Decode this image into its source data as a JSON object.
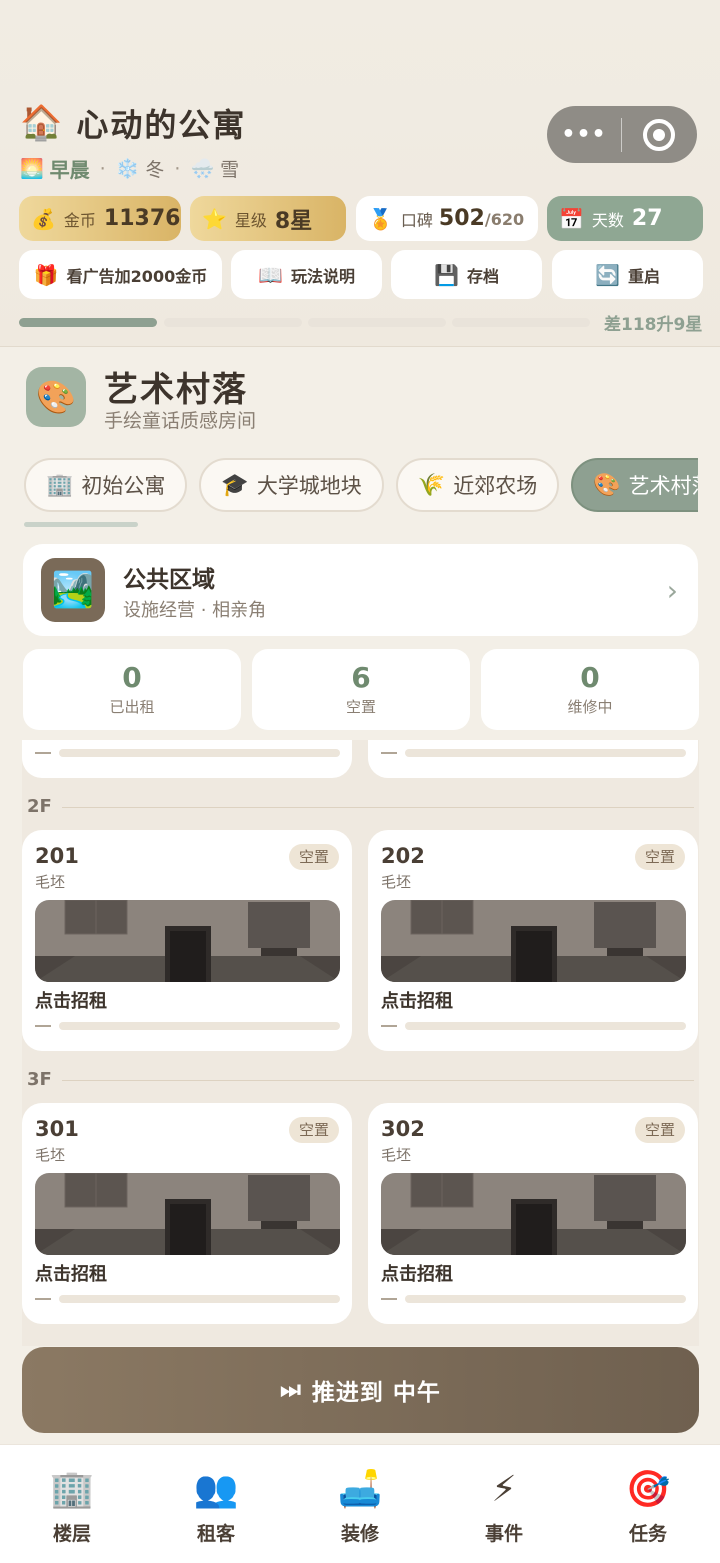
{
  "header": {
    "title": "心动的公寓",
    "title_icon": "🏠",
    "time_icon": "🌅",
    "time_of_day": "早晨",
    "season_icon": "❄️",
    "season": "冬",
    "weather_icon": "🌨️",
    "weather": "雪",
    "separator": "·"
  },
  "capsule": {
    "more": "•••"
  },
  "stats": {
    "coins_label": "金币",
    "coins_value": "11376",
    "coins_icon": "💰",
    "stars_label": "星级",
    "stars_value": "8星",
    "stars_icon": "⭐",
    "rep_label": "口碑",
    "rep_value": "502",
    "rep_max": "/620",
    "rep_icon": "🏅",
    "days_label": "天数",
    "days_value": "27",
    "days_icon": "📅"
  },
  "actions": {
    "ad": "看广告加2000金币",
    "ad_icon": "🎁",
    "guide": "玩法说明",
    "guide_icon": "📖",
    "save": "存档",
    "save_icon": "💾",
    "restart": "重启",
    "restart_icon": "🔄"
  },
  "progress": {
    "text": "差118升9星",
    "filled_segments": 1,
    "total_segments": 4
  },
  "area": {
    "icon": "🎨",
    "name": "艺术村落",
    "subtitle": "手绘童话质感房间"
  },
  "tabs": [
    {
      "icon": "🏢",
      "label": "初始公寓"
    },
    {
      "icon": "🎓",
      "label": "大学城地块"
    },
    {
      "icon": "🌾",
      "label": "近郊农场"
    },
    {
      "icon": "🎨",
      "label": "艺术村落"
    }
  ],
  "public_area": {
    "icon": "🏞️",
    "title": "公共区域",
    "subtitle": "设施经营 · 相亲角",
    "chevron": "›"
  },
  "counts": [
    {
      "value": "0",
      "label": "已出租"
    },
    {
      "value": "6",
      "label": "空置"
    },
    {
      "value": "0",
      "label": "维修中"
    }
  ],
  "floors": [
    {
      "label": "2F",
      "rooms": [
        {
          "number": "201",
          "type": "毛坯",
          "status": "空置",
          "action": "点击招租",
          "dash": "—"
        },
        {
          "number": "202",
          "type": "毛坯",
          "status": "空置",
          "action": "点击招租",
          "dash": "—"
        }
      ]
    },
    {
      "label": "3F",
      "rooms": [
        {
          "number": "301",
          "type": "毛坯",
          "status": "空置",
          "action": "点击招租",
          "dash": "—"
        },
        {
          "number": "302",
          "type": "毛坯",
          "status": "空置",
          "action": "点击招租",
          "dash": "—"
        }
      ]
    }
  ],
  "partial_dash": "—",
  "advance": {
    "icon": "⏭",
    "label": "推进到 中午"
  },
  "nav": [
    {
      "icon": "🏢",
      "label": "楼层"
    },
    {
      "icon": "👥",
      "label": "租客"
    },
    {
      "icon": "🛋️",
      "label": "装修"
    },
    {
      "icon": "⚡",
      "label": "事件"
    },
    {
      "icon": "🎯",
      "label": "任务"
    }
  ]
}
